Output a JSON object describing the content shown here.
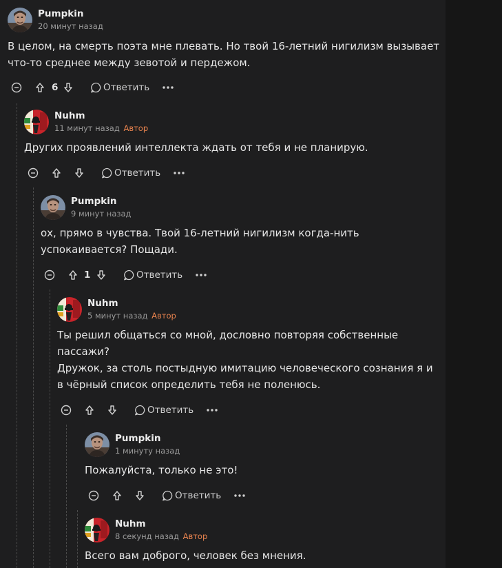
{
  "comments": [
    {
      "author": "Pumpkin",
      "time": "20 минут назад",
      "badge": "",
      "lines": [
        "В целом, на смерть поэта мне плевать. Но твой 16-летний нигилизм вызывает",
        "что-то среднее между зевотой и пердежом."
      ],
      "votes": "6",
      "reply_label": "Ответить"
    },
    {
      "author": "Nuhm",
      "time": "11 минут назад",
      "badge": "Автор",
      "lines": [
        "Других проявлений интеллекта ждать от тебя и не планирую."
      ],
      "votes": "",
      "reply_label": "Ответить"
    },
    {
      "author": "Pumpkin",
      "time": "9 минут назад",
      "badge": "",
      "lines": [
        "ох, прямо в чувства. Твой 16-летний нигилизм когда-нить",
        "успокаивается? Пощади."
      ],
      "votes": "1",
      "reply_label": "Ответить"
    },
    {
      "author": "Nuhm",
      "time": "5 минут назад",
      "badge": "Автор",
      "lines": [
        "Ты решил общаться со мной, дословно повторяя собственные",
        "пассажи?",
        "Дружок, за столь постыдную имитацию человеческого сознания я и",
        "в чёрный список определить тебя не поленюсь."
      ],
      "votes": "",
      "reply_label": "Ответить"
    },
    {
      "author": "Pumpkin",
      "time": "1 минуту назад",
      "badge": "",
      "lines": [
        "Пожалуйста, только не это!"
      ],
      "votes": "",
      "reply_label": "Ответить"
    },
    {
      "author": "Nuhm",
      "time": "8 секунд назад",
      "badge": "Автор",
      "lines": [
        "Всего вам доброго, человек без мнения."
      ],
      "votes": "",
      "reply_label": ""
    }
  ],
  "icons": {
    "collapse": "minus-circle-icon",
    "upvote": "arrow-up-icon",
    "downvote": "arrow-down-icon",
    "reply": "speech-bubble-icon",
    "more": "ellipsis-icon"
  },
  "colors": {
    "background": "#1e1e1f",
    "author_badge": "#e8834e",
    "meta": "#9a9a9a"
  }
}
